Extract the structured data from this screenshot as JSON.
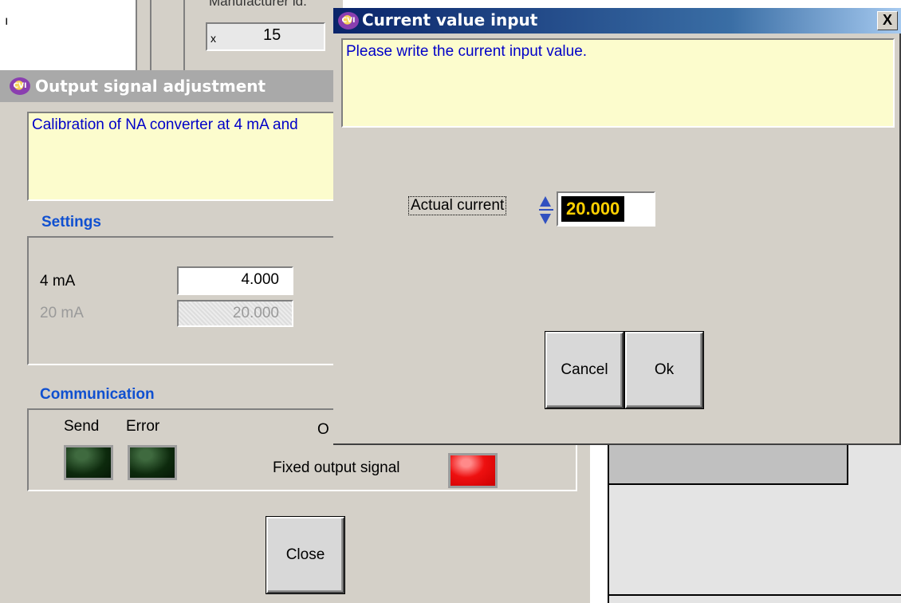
{
  "background_window": {
    "label": "Manufacturer id.",
    "field_prefix": "x",
    "field_value": "15",
    "left_glyph": "ı"
  },
  "output_window": {
    "title": "Output signal adjustment",
    "logo_text": "CVI",
    "message": "Calibration of NA converter at 4 mA and",
    "settings": {
      "heading": "Settings",
      "rows": [
        {
          "label": "4 mA",
          "value": "4.000"
        },
        {
          "label": "20 mA",
          "value": "20.000"
        }
      ]
    },
    "communication": {
      "heading": "Communication",
      "send_label": "Send",
      "error_label": "Error",
      "partial_label": "O",
      "fixed_output_label": "Fixed output signal"
    },
    "close_label": "Close"
  },
  "current_dialog": {
    "title": "Current value input",
    "logo_text": "CVI",
    "close_glyph": "X",
    "message": "Please write the current input value.",
    "actual_current_label": "Actual current",
    "actual_current_value": "20.000",
    "cancel_label": "Cancel",
    "ok_label": "Ok"
  },
  "colors": {
    "message_bg": "#fcfccd",
    "message_text": "#0000c8",
    "section_heading": "#1050d0",
    "active_title": "#0a246a",
    "led_off": "#0d2a0d",
    "led_red": "#ee1010"
  }
}
